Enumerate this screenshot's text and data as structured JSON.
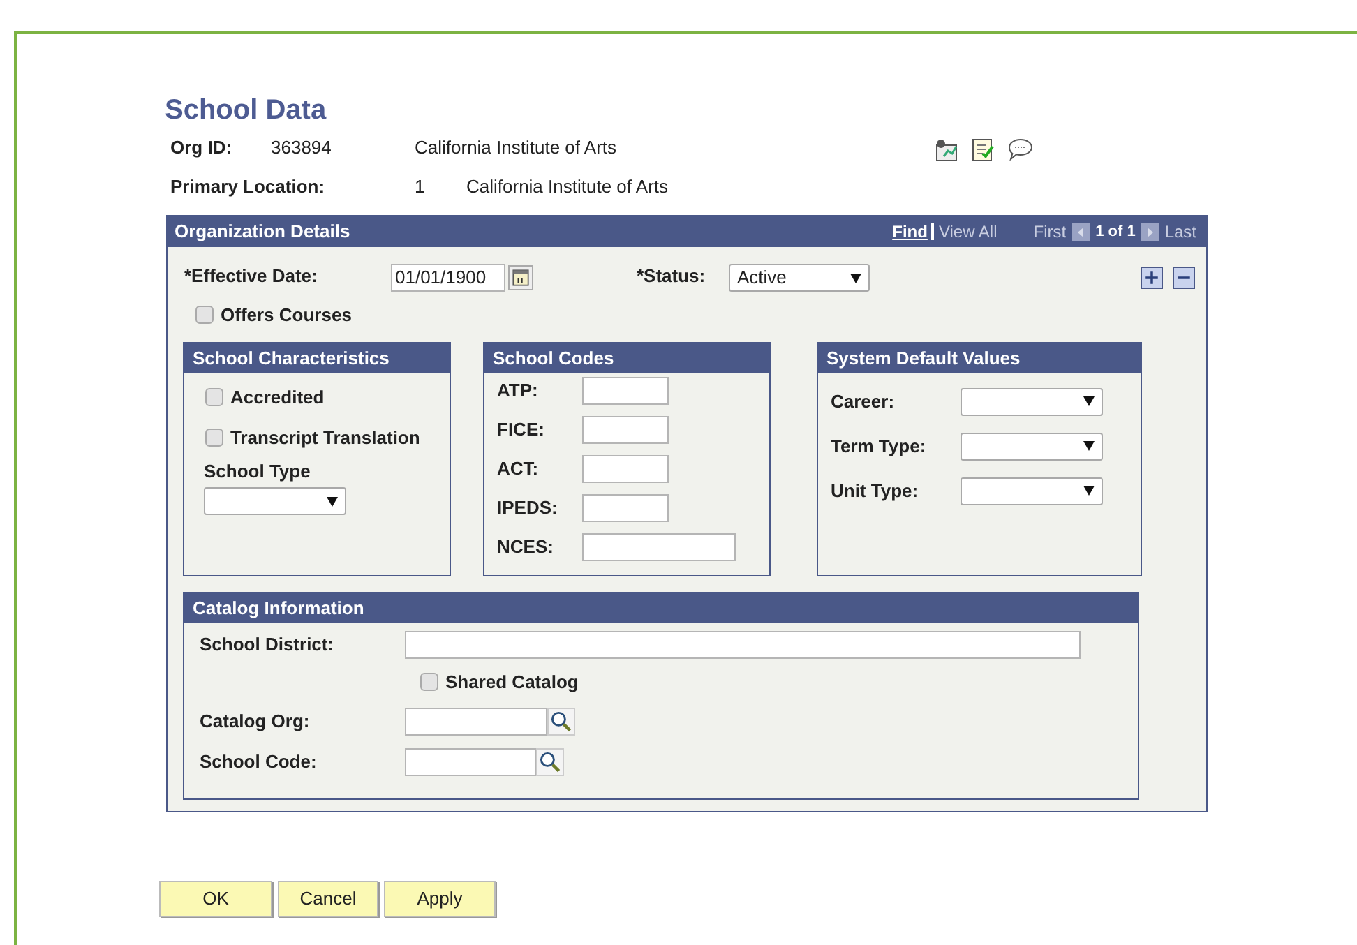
{
  "page": {
    "title": "School Data"
  },
  "header_fields": [
    {
      "label": "Org ID:",
      "value": "363894",
      "description": "California Institute of Arts"
    },
    {
      "label": "Primary Location:",
      "value": "1",
      "description": "California Institute of Arts"
    }
  ],
  "organization_details": {
    "title": "Organization Details",
    "nav": {
      "find": "Find",
      "view_all": "View All",
      "first": "First",
      "count": "1 of 1",
      "last": "Last"
    },
    "effective_date": {
      "label": "*Effective Date:",
      "value": "01/01/1900"
    },
    "status": {
      "label": "*Status:",
      "value": "Active"
    },
    "offers_courses": {
      "label": "Offers Courses",
      "checked": false
    },
    "school_characteristics": {
      "title": "School Characteristics",
      "checkboxes": [
        {
          "label": "Accredited",
          "checked": false
        },
        {
          "label": "Transcript Translation",
          "checked": false
        }
      ],
      "school_type": {
        "label": "School Type"
      }
    },
    "school_codes": {
      "title": "School Codes",
      "fields": [
        {
          "label": "ATP:"
        },
        {
          "label": "FICE:"
        },
        {
          "label": "ACT:"
        },
        {
          "label": "IPEDS:"
        },
        {
          "label": "NCES:"
        }
      ]
    },
    "system_default_values": {
      "title": "System Default Values",
      "dropdowns": [
        {
          "label": "Career:"
        },
        {
          "label": "Term Type:"
        },
        {
          "label": "Unit Type:"
        }
      ]
    },
    "catalog_information": {
      "title": "Catalog Information",
      "school_district": {
        "label": "School District:"
      },
      "shared_catalog": {
        "label": "Shared Catalog",
        "checked": false
      },
      "catalog_org": {
        "label": "Catalog Org:"
      },
      "school_code": {
        "label": "School Code:"
      }
    }
  },
  "buttons": [
    "OK",
    "Cancel",
    "Apply"
  ]
}
